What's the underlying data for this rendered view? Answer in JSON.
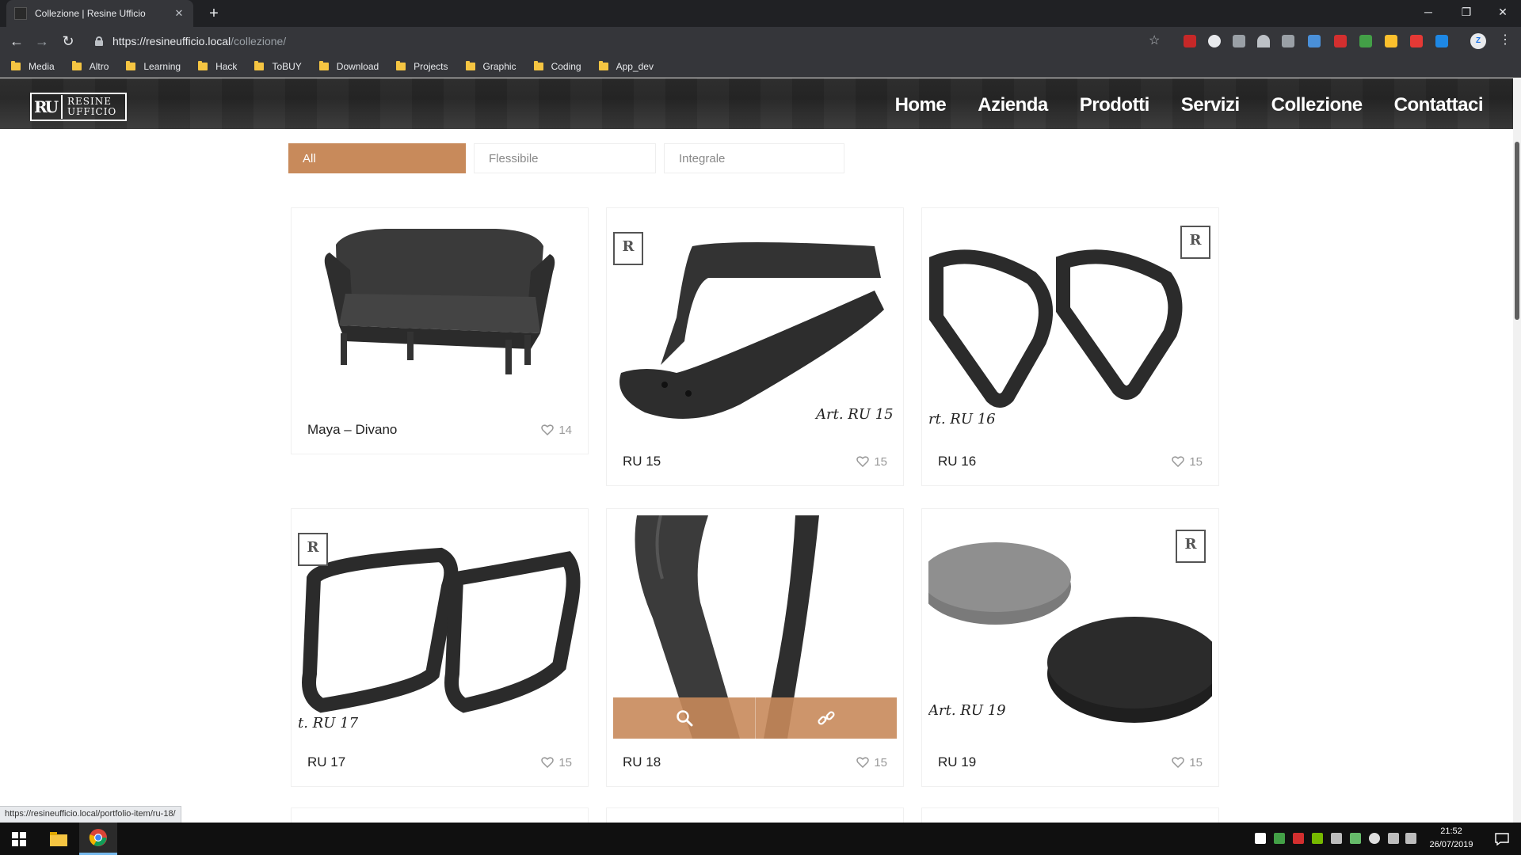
{
  "browser": {
    "tab_title": "Collezione | Resine Ufficio",
    "new_tab": "+",
    "url_host": "https://resineufficio.local",
    "url_path": "/collezione/",
    "status_url": "https://resineufficio.local/portfolio-item/ru-18/",
    "window_controls": {
      "minimize": "─",
      "restore": "❐",
      "close": "✕"
    }
  },
  "bookmarks": [
    "Media",
    "Altro",
    "Learning",
    "Hack",
    "ToBUY",
    "Download",
    "Projects",
    "Graphic",
    "Coding",
    "App_dev"
  ],
  "site": {
    "logo_mark": "RU",
    "logo_line1": "RESINE",
    "logo_line2": "UFFICIO",
    "nav": [
      "Home",
      "Azienda",
      "Prodotti",
      "Servizi",
      "Collezione",
      "Contattaci"
    ]
  },
  "filters": {
    "all": "All",
    "flex": "Flessibile",
    "integral": "Integrale"
  },
  "products": [
    {
      "name": "Maya – Divano",
      "likes": "14"
    },
    {
      "name": "RU 15",
      "likes": "15",
      "art": "Art. RU 15"
    },
    {
      "name": "RU 16",
      "likes": "15",
      "art": "rt. RU 16"
    },
    {
      "name": "RU 17",
      "likes": "15",
      "art": "t. RU 17"
    },
    {
      "name": "RU 18",
      "likes": "15"
    },
    {
      "name": "RU 19",
      "likes": "15",
      "art": "Art. RU 19"
    }
  ],
  "taskbar": {
    "time": "21:52",
    "date": "26/07/2019"
  },
  "colors": {
    "accent": "#c88a5b",
    "header_bg": "#2a2a2a",
    "chrome_bg": "#35363a"
  }
}
